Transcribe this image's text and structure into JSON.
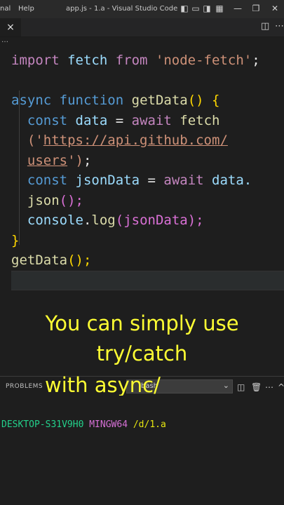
{
  "titlebar": {
    "menu_partial": "nal",
    "menu_help": "Help",
    "title": "app.js - 1.a - Visual Studio Code"
  },
  "tab": {
    "close_glyph": "×"
  },
  "breadcrumb_dots": "…",
  "code": {
    "line1": [
      "import",
      " fetch ",
      "from",
      " 'node-fetch'",
      ";"
    ],
    "line3a": "async",
    "line3b": "function",
    "line3c": "getData",
    "line4a": "const",
    "line4b": " data ",
    "line4c": "= ",
    "line4d": "await",
    "line4e": " fetch",
    "line5a": "('",
    "line5b": "https://api.github.com/",
    "line6a": "users",
    "line6b": "')",
    "line6c": ";",
    "line7a": "const",
    "line7b": " jsonData ",
    "line7c": "= ",
    "line7d": "await",
    "line7e": " data.",
    "line8a": "json",
    "line8b": "();",
    "line9a": "console",
    "line9b": ".",
    "line9c": "log",
    "line9d": "(jsonData);",
    "line10": "}",
    "line11a": "getData",
    "line11b": "();"
  },
  "caption": {
    "line1": "You can simply use",
    "line2": "try/catch",
    "line3": "with async/"
  },
  "panel": {
    "problems_label": "PROBLEMS",
    "terminal_select_value": "bash"
  },
  "terminal": {
    "host": "DESKTOP-S31V9H0",
    "shell": "MINGW64",
    "path": "/d/1.a"
  },
  "colors": {
    "caption": "#ffff33",
    "keyword": "#c586c0",
    "string": "#ce9178",
    "function": "#dcdcaa"
  }
}
